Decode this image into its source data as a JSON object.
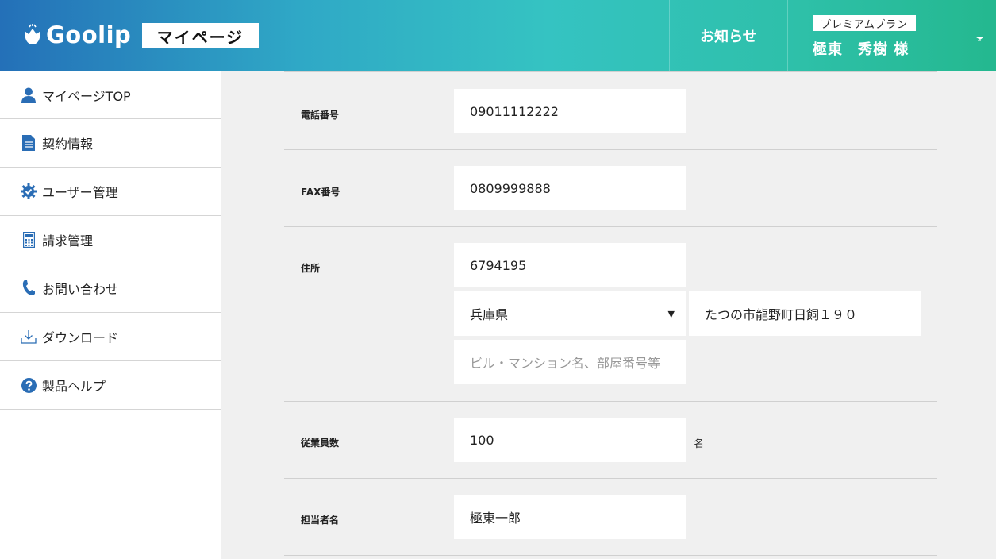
{
  "header": {
    "brand": "Goolip",
    "page_badge": "マイページ",
    "notice": "お知らせ",
    "plan": "プレミアムプラン",
    "user_name": "極東　秀樹 様"
  },
  "sidebar": {
    "items": [
      {
        "label": "マイページTOP",
        "icon": "user-icon"
      },
      {
        "label": "契約情報",
        "icon": "document-icon"
      },
      {
        "label": "ユーザー管理",
        "icon": "gear-check-icon"
      },
      {
        "label": "請求管理",
        "icon": "calculator-icon"
      },
      {
        "label": "お問い合わせ",
        "icon": "phone-icon"
      },
      {
        "label": "ダウンロード",
        "icon": "download-icon"
      },
      {
        "label": "製品ヘルプ",
        "icon": "help-icon"
      }
    ]
  },
  "form": {
    "phone": {
      "label": "電話番号",
      "value": "09011112222"
    },
    "fax": {
      "label": "FAX番号",
      "value": "0809999888"
    },
    "address": {
      "label": "住所",
      "postal": "6794195",
      "prefecture": "兵庫県",
      "city": "たつの市龍野町日飼１９０",
      "building_placeholder": "ビル・マンション名、部屋番号等"
    },
    "employees": {
      "label": "従業員数",
      "value": "100",
      "unit": "名"
    },
    "contact": {
      "label": "担当者名",
      "value": "極東一郎"
    }
  },
  "colors": {
    "accent": "#2a6db5",
    "header_start": "#2470b8",
    "header_end": "#24b88f"
  }
}
